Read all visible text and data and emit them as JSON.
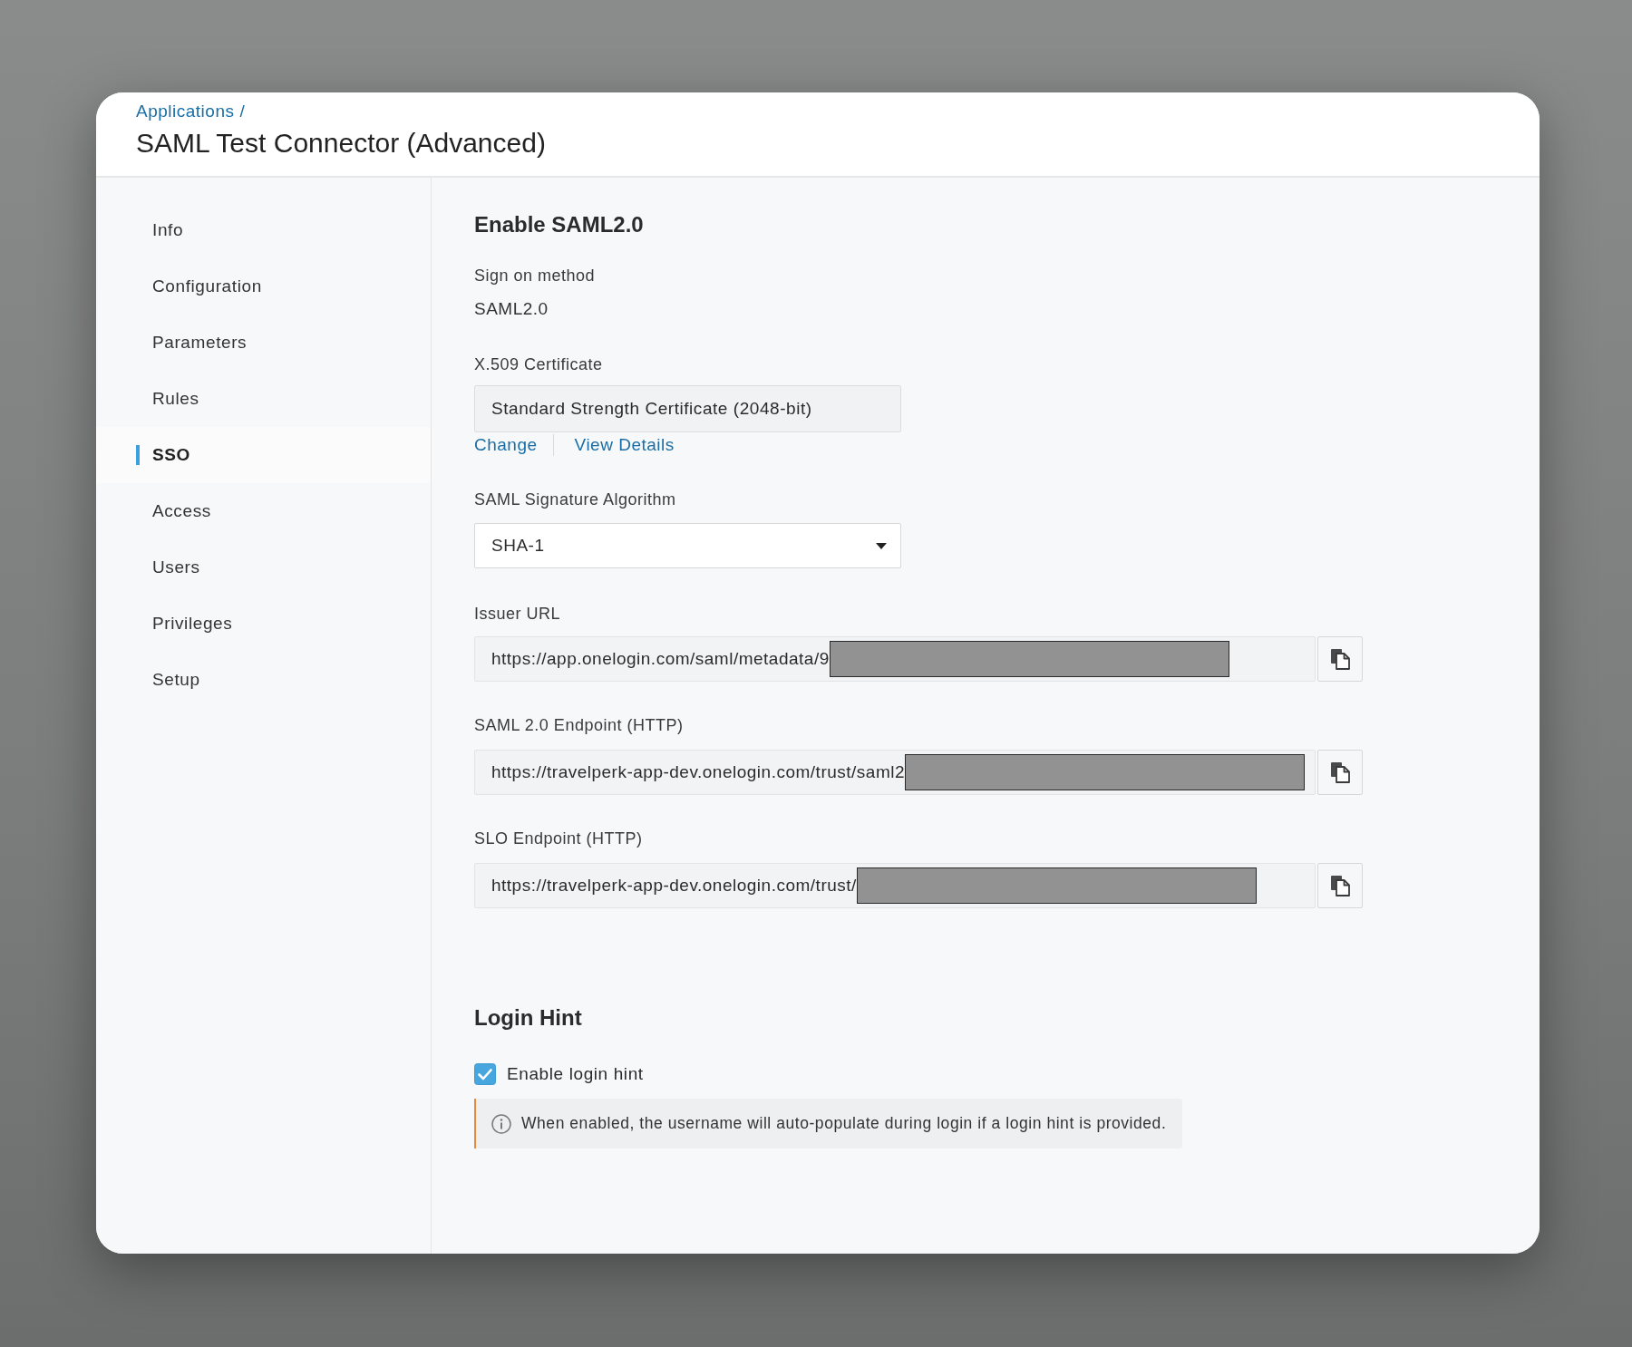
{
  "header": {
    "breadcrumb": {
      "link": "Applications",
      "separator": "/"
    },
    "title": "SAML Test Connector (Advanced)"
  },
  "sidebar": {
    "items": [
      {
        "label": "Info",
        "selected": false
      },
      {
        "label": "Configuration",
        "selected": false
      },
      {
        "label": "Parameters",
        "selected": false
      },
      {
        "label": "Rules",
        "selected": false
      },
      {
        "label": "SSO",
        "selected": true
      },
      {
        "label": "Access",
        "selected": false
      },
      {
        "label": "Users",
        "selected": false
      },
      {
        "label": "Privileges",
        "selected": false
      },
      {
        "label": "Setup",
        "selected": false
      }
    ]
  },
  "saml_section": {
    "heading": "Enable SAML2.0",
    "sign_on_method": {
      "label": "Sign on method",
      "value": "SAML2.0"
    },
    "certificate": {
      "label": "X.509 Certificate",
      "value": "Standard Strength Certificate (2048-bit)",
      "links": [
        "Change",
        "View Details"
      ]
    },
    "signature_algorithm": {
      "label": "SAML Signature Algorithm",
      "value": "SHA-1"
    },
    "url_fields": [
      {
        "label": "Issuer URL",
        "value": "https://app.onelogin.com/saml/metadata/9",
        "redacted": true
      },
      {
        "label": "SAML 2.0 Endpoint (HTTP)",
        "value": "https://travelperk-app-dev.onelogin.com/trust/saml2",
        "redacted": true
      },
      {
        "label": "SLO Endpoint (HTTP)",
        "value": "https://travelperk-app-dev.onelogin.com/trust/",
        "redacted": true
      }
    ]
  },
  "login_hint": {
    "heading": "Login Hint",
    "checkbox": {
      "label": "Enable login hint",
      "checked": true
    },
    "note": "When enabled, the username will auto-populate during login if a login hint is provided."
  }
}
